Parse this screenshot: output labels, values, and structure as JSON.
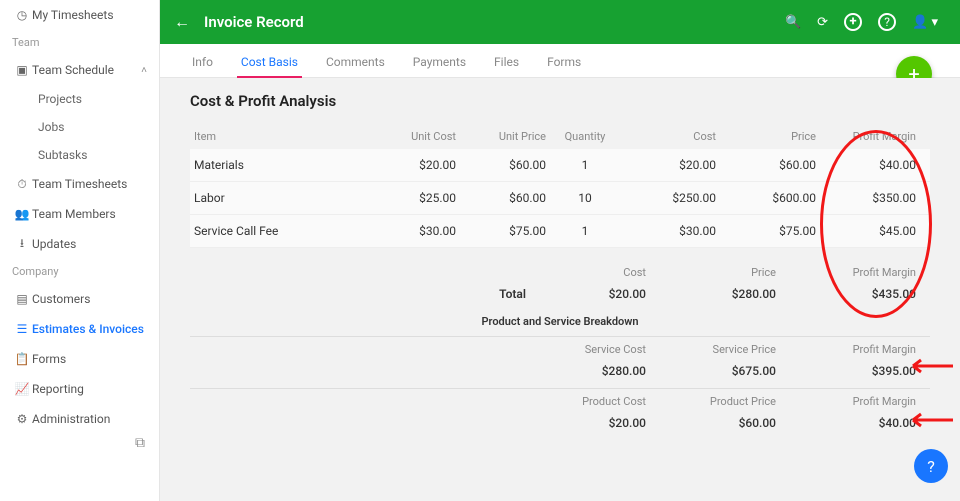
{
  "sidebar": {
    "myTimesheets": "My Timesheets",
    "teamSection": "Team",
    "teamSchedule": "Team Schedule",
    "projects": "Projects",
    "jobs": "Jobs",
    "subtasks": "Subtasks",
    "teamTimesheets": "Team Timesheets",
    "teamMembers": "Team Members",
    "updates": "Updates",
    "companySection": "Company",
    "customers": "Customers",
    "estimates": "Estimates & Invoices",
    "forms": "Forms",
    "reporting": "Reporting",
    "administration": "Administration"
  },
  "header": {
    "title": "Invoice Record"
  },
  "tabs": {
    "info": "Info",
    "costBasis": "Cost Basis",
    "comments": "Comments",
    "payments": "Payments",
    "files": "Files",
    "forms": "Forms"
  },
  "analysis": {
    "title": "Cost & Profit Analysis",
    "columns": {
      "item": "Item",
      "unitCost": "Unit Cost",
      "unitPrice": "Unit Price",
      "qty": "Quantity",
      "cost": "Cost",
      "price": "Price",
      "margin": "Profit Margin"
    },
    "rows": [
      {
        "item": "Materials",
        "unitCost": "$20.00",
        "unitPrice": "$60.00",
        "qty": "1",
        "cost": "$20.00",
        "price": "$60.00",
        "margin": "$40.00"
      },
      {
        "item": "Labor",
        "unitCost": "$25.00",
        "unitPrice": "$60.00",
        "qty": "10",
        "cost": "$250.00",
        "price": "$600.00",
        "margin": "$350.00"
      },
      {
        "item": "Service Call Fee",
        "unitCost": "$30.00",
        "unitPrice": "$75.00",
        "qty": "1",
        "cost": "$30.00",
        "price": "$75.00",
        "margin": "$45.00"
      }
    ],
    "totals": {
      "labels": {
        "cost": "Cost",
        "price": "Price",
        "margin": "Profit Margin",
        "total": "Total"
      },
      "cost": "$20.00",
      "price": "$280.00",
      "margin": "$435.00"
    },
    "breakdownTitle": "Product and Service Breakdown",
    "service": {
      "labels": {
        "cost": "Service Cost",
        "price": "Service Price",
        "margin": "Profit Margin"
      },
      "cost": "$280.00",
      "price": "$675.00",
      "margin": "$395.00"
    },
    "product": {
      "labels": {
        "cost": "Product Cost",
        "price": "Product Price",
        "margin": "Profit Margin"
      },
      "cost": "$20.00",
      "price": "$60.00",
      "margin": "$40.00"
    }
  }
}
